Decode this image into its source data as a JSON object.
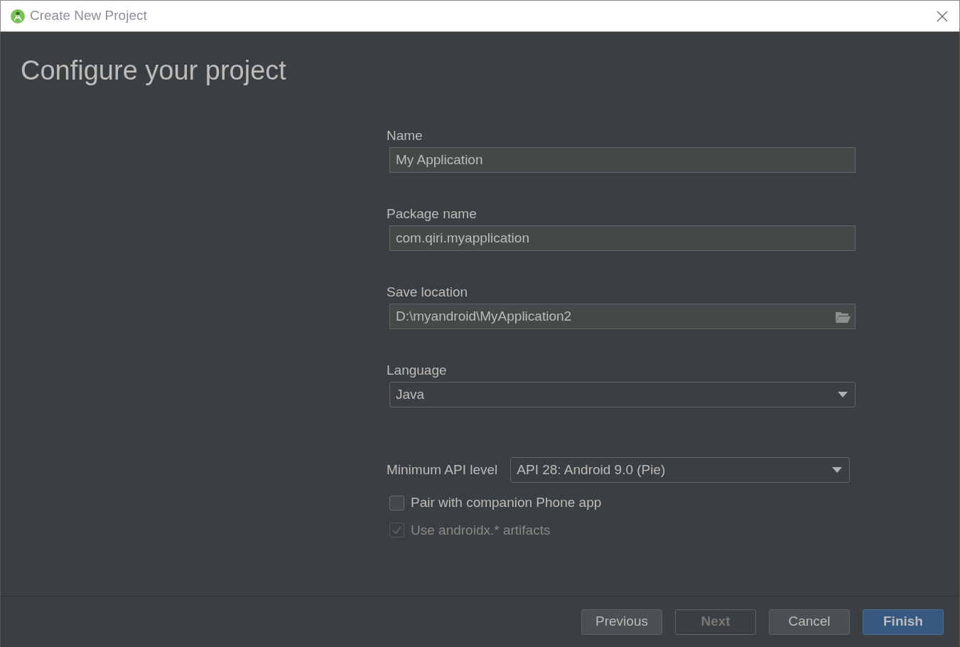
{
  "window": {
    "title": "Create New Project"
  },
  "heading": "Configure your project",
  "fields": [
    {
      "label": "Name",
      "kind": "text",
      "value": "My Application"
    },
    {
      "label": "Package name",
      "kind": "text",
      "value": "com.qiri.myapplication"
    },
    {
      "label": "Save location",
      "kind": "folder",
      "value": "D:\\myandroid\\MyApplication2"
    },
    {
      "label": "Language",
      "kind": "dropdown",
      "value": "Java"
    }
  ],
  "min_api": {
    "label": "Minimum API level",
    "value": "API 28: Android 9.0 (Pie)"
  },
  "checkboxes": [
    {
      "label": "Pair with companion Phone app",
      "checked": false,
      "disabled": false
    },
    {
      "label": "Use androidx.* artifacts",
      "checked": true,
      "disabled": true
    }
  ],
  "buttons": [
    {
      "label": "Previous",
      "kind": "normal"
    },
    {
      "label": "Next",
      "kind": "disabled"
    },
    {
      "label": "Cancel",
      "kind": "normal"
    },
    {
      "label": "Finish",
      "kind": "default"
    }
  ]
}
